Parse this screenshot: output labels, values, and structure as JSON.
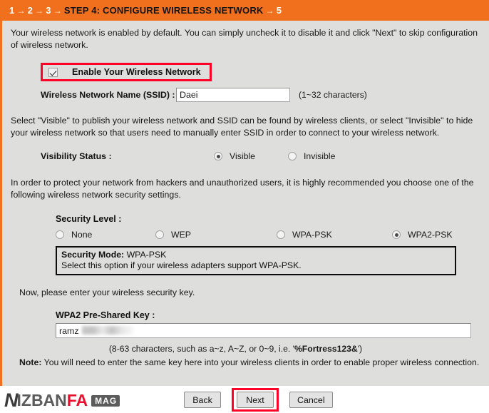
{
  "header": {
    "steps_before": [
      "1",
      "2",
      "3"
    ],
    "arrow": "→",
    "current_step": "STEP 4: CONFIGURE WIRELESS NETWORK",
    "step_after": "5",
    "bg_color": "#f0701e"
  },
  "intro": {
    "paragraph": "Your wireless network is enabled by default. You can simply uncheck it to disable it and click \"Next\" to skip configuration of wireless network."
  },
  "enable": {
    "label": "Enable Your Wireless Network",
    "checked": true,
    "highlight_color": "#ff0026"
  },
  "ssid": {
    "label": "Wireless Network Name (SSID) :",
    "value": "Daei",
    "placeholder": "",
    "hint": "(1~32 characters)"
  },
  "visibility": {
    "paragraph": "Select \"Visible\" to publish your wireless network and SSID can be found by wireless clients, or select \"Invisible\" to hide your wireless network so that users need to manually enter SSID in order to connect to your wireless network.",
    "label": "Visibility Status :",
    "options": [
      {
        "label": "Visible",
        "selected": true
      },
      {
        "label": "Invisible",
        "selected": false
      }
    ]
  },
  "security": {
    "paragraph": "In order to protect your network from hackers and unauthorized users, it is highly recommended you choose one of the following wireless network security settings.",
    "level_label": "Security Level :",
    "levels": [
      {
        "label": "None",
        "selected": false
      },
      {
        "label": "WEP",
        "selected": false
      },
      {
        "label": "WPA-PSK",
        "selected": false
      },
      {
        "label": "WPA2-PSK",
        "selected": true
      }
    ],
    "mode_box": {
      "title_label": "Security Mode:",
      "title_value": "WPA-PSK",
      "description": "Select this option if your wireless adapters support WPA-PSK."
    }
  },
  "key": {
    "intro": "Now, please enter your wireless security key.",
    "label": "WPA2 Pre-Shared Key :",
    "value": "ramz",
    "placeholder": "",
    "redacted": true,
    "hint_plain_a": "(8-63 characters, such as a~z, A~Z, or 0~9, i.e. '",
    "hint_bold": "%Fortress123&",
    "hint_plain_b": "')",
    "note_label": "Note:",
    "note_text": " You will need to enter the same key here into your wireless clients in order to enable proper wireless connection."
  },
  "footer": {
    "back_label": "Back",
    "next_label": "Next",
    "cancel_label": "Cancel",
    "highlight_color": "#ff0026"
  },
  "logo": {
    "letter_n": "N",
    "part_gray": "IZBAN",
    "part_red": "FA",
    "badge": "MAG"
  }
}
